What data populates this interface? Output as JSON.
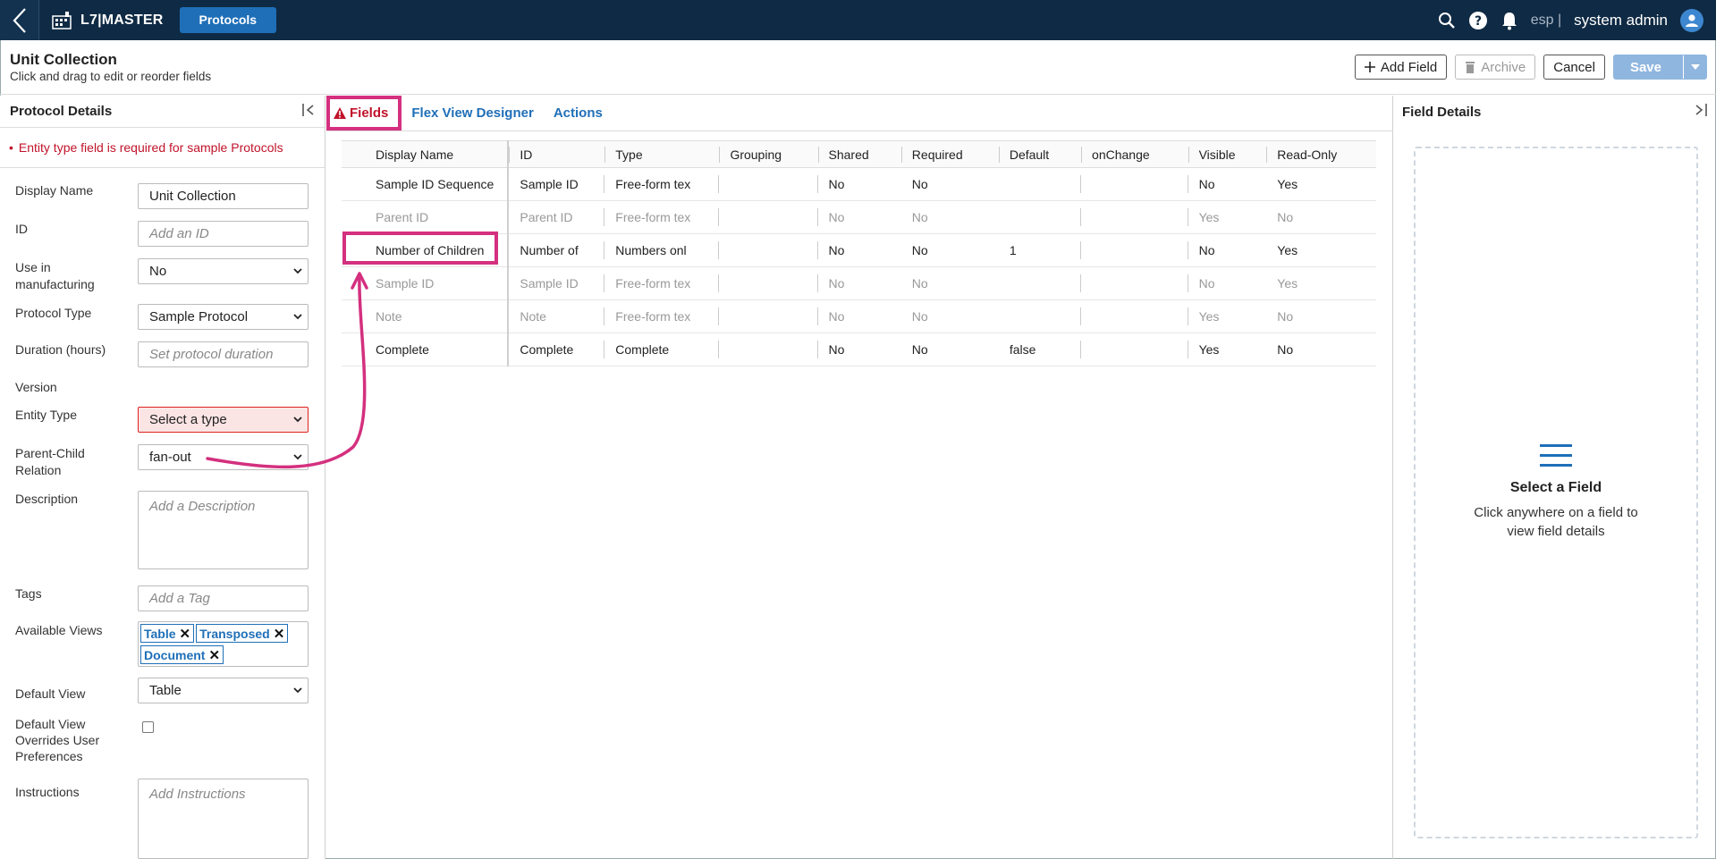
{
  "topbar": {
    "brand": "L7|MASTER",
    "active_app": "Protocols",
    "lang": "esp |",
    "user": "system admin",
    "icons": [
      "back-chevron-icon",
      "search-icon",
      "help-icon",
      "bell-icon",
      "user-icon"
    ]
  },
  "header": {
    "title": "Unit Collection",
    "subtitle": "Click and drag to edit or reorder fields",
    "add_field": "Add Field",
    "archive": "Archive",
    "cancel": "Cancel",
    "save": "Save"
  },
  "left_panel": {
    "title": "Protocol Details",
    "error": "Entity type field is required for sample Protocols",
    "fields": {
      "display_name_label": "Display Name",
      "display_name_value": "Unit Collection",
      "id_label": "ID",
      "id_placeholder": "Add an ID",
      "manufacturing_label_1": "Use in",
      "manufacturing_label_2": "manufacturing",
      "manufacturing_value": "No",
      "protocol_type_label": "Protocol Type",
      "protocol_type_value": "Sample Protocol",
      "duration_label": "Duration (hours)",
      "duration_placeholder": "Set protocol duration",
      "version_label": "Version",
      "entity_type_label": "Entity Type",
      "entity_type_value": "Select a type",
      "parent_child_label_1": "Parent-Child",
      "parent_child_label_2": "Relation",
      "parent_child_value": "fan-out",
      "description_label": "Description",
      "description_placeholder": "Add a Description",
      "tags_label": "Tags",
      "tags_placeholder": "Add a Tag",
      "views_label": "Available Views",
      "views": [
        "Table",
        "Transposed",
        "Document"
      ],
      "default_view_label": "Default View",
      "default_view_value": "Table",
      "override_label_1": "Default View",
      "override_label_2": "Overrides User",
      "override_label_3": "Preferences",
      "override_checked": false,
      "instructions_label": "Instructions",
      "instructions_placeholder": "Add Instructions"
    }
  },
  "tabs": [
    "Fields",
    "Flex View Designer",
    "Actions"
  ],
  "grid": {
    "columns": [
      "Display Name",
      "ID",
      "Type",
      "Grouping",
      "Shared",
      "Required",
      "Default",
      "onChange",
      "Visible",
      "Read-Only"
    ],
    "rows": [
      {
        "cells": [
          "Sample ID Sequence",
          "Sample ID",
          "Free-form tex",
          "",
          "No",
          "No",
          "",
          "",
          "No",
          "Yes"
        ],
        "muted": false
      },
      {
        "cells": [
          "Parent ID",
          "Parent ID",
          "Free-form tex",
          "",
          "No",
          "No",
          "",
          "",
          "Yes",
          "No"
        ],
        "muted": true
      },
      {
        "cells": [
          "Number of Children",
          "Number of",
          "Numbers onl",
          "",
          "No",
          "No",
          "1",
          "",
          "No",
          "Yes"
        ],
        "muted": false
      },
      {
        "cells": [
          "Sample ID",
          "Sample ID",
          "Free-form tex",
          "",
          "No",
          "No",
          "",
          "",
          "No",
          "Yes"
        ],
        "muted": true
      },
      {
        "cells": [
          "Note",
          "Note",
          "Free-form tex",
          "",
          "No",
          "No",
          "",
          "",
          "Yes",
          "No"
        ],
        "muted": true
      },
      {
        "cells": [
          "Complete",
          "Complete",
          "Complete",
          "",
          "No",
          "No",
          "false",
          "",
          "Yes",
          "No"
        ],
        "muted": false
      }
    ]
  },
  "right_panel": {
    "title": "Field Details",
    "empty_title": "Select a Field",
    "empty_text": "Click anywhere on a field to view field details"
  },
  "colors": {
    "topbar": "#0f2a44",
    "accent": "#1f6fb8",
    "error": "#c0132a",
    "annotation": "#d4307f"
  }
}
